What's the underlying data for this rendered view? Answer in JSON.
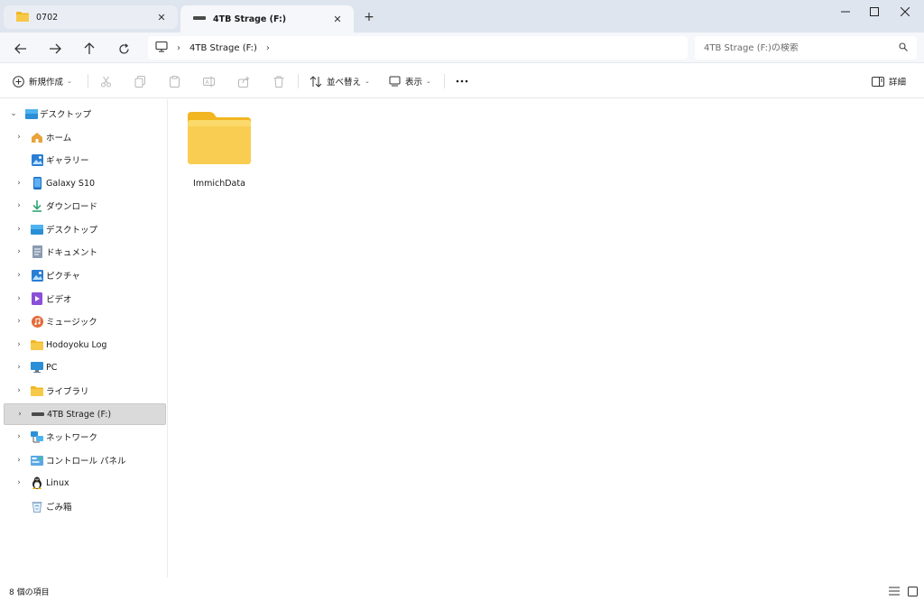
{
  "tabs": [
    {
      "label": "0702",
      "icon": "folder-icon",
      "active": false
    },
    {
      "label": "4TB Strage (F:)",
      "icon": "drive-icon",
      "active": true
    }
  ],
  "address": {
    "crumbs": [
      "4TB Strage (F:)"
    ],
    "search_placeholder": "4TB Strage (F:)の検索"
  },
  "commands": {
    "new_label": "新規作成",
    "sort_label": "並べ替え",
    "view_label": "表示",
    "details_label": "詳細"
  },
  "sidebar": {
    "root": {
      "label": "デスクトップ",
      "icon": "desktop-icon"
    },
    "items": [
      {
        "label": "ホーム",
        "icon": "home-icon"
      },
      {
        "label": "ギャラリー",
        "icon": "gallery-icon"
      },
      {
        "label": "Galaxy S10",
        "icon": "phone-icon"
      },
      {
        "label": "ダウンロード",
        "icon": "download-icon"
      },
      {
        "label": "デスクトップ",
        "icon": "desktop-icon"
      },
      {
        "label": "ドキュメント",
        "icon": "document-icon"
      },
      {
        "label": "ピクチャ",
        "icon": "pictures-icon"
      },
      {
        "label": "ビデオ",
        "icon": "video-icon"
      },
      {
        "label": "ミュージック",
        "icon": "music-icon"
      },
      {
        "label": "Hodoyoku Log",
        "icon": "folder-icon"
      },
      {
        "label": "PC",
        "icon": "pc-icon"
      },
      {
        "label": "ライブラリ",
        "icon": "library-icon"
      },
      {
        "label": "4TB Strage (F:)",
        "icon": "drive-icon",
        "selected": true
      },
      {
        "label": "ネットワーク",
        "icon": "network-icon"
      },
      {
        "label": "コントロール パネル",
        "icon": "control-panel-icon"
      },
      {
        "label": "Linux",
        "icon": "linux-icon"
      },
      {
        "label": "ごみ箱",
        "icon": "recycle-bin-icon"
      }
    ]
  },
  "content": {
    "files": [
      {
        "name": "ImmichData",
        "icon": "folder-icon"
      }
    ]
  },
  "status": {
    "text": "8 個の項目"
  },
  "colors": {
    "folder": "#f7c948",
    "folder_tab": "#f2b622",
    "selected_bg": "#dadada",
    "titlebar": "#dfe5ee"
  }
}
